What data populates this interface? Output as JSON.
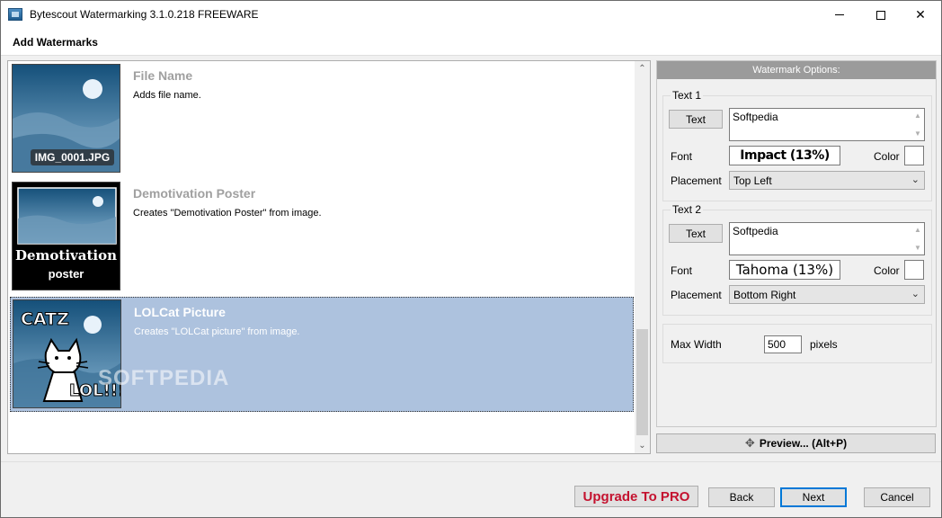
{
  "window": {
    "title": "Bytescout Watermarking 3.1.0.218 FREEWARE"
  },
  "header": {
    "title": "Add Watermarks"
  },
  "list": {
    "items": [
      {
        "title": "File Name",
        "description": "Adds file name.",
        "thumb_label": "IMG_0001.JPG"
      },
      {
        "title": "Demotivation Poster",
        "description": "Creates \"Demotivation Poster\" from image.",
        "thumb_line1": "Demotivation",
        "thumb_line2": "poster"
      },
      {
        "title": "LOLCat Picture",
        "description": "Creates \"LOLCat picture\" from image.",
        "thumb_top": "CATZ",
        "thumb_bottom": "LOL!!!",
        "selected": true
      }
    ],
    "overlay_watermark": "SOFTPEDIA"
  },
  "options": {
    "header": "Watermark Options:",
    "text1": {
      "legend": "Text 1",
      "button": "Text",
      "value": "Softpedia",
      "font_label": "Font",
      "font_value": "Impact (13%)",
      "color_label": "Color",
      "placement_label": "Placement",
      "placement_value": "Top Left"
    },
    "text2": {
      "legend": "Text 2",
      "button": "Text",
      "value": "Softpedia",
      "font_label": "Font",
      "font_value": "Tahoma (13%)",
      "color_label": "Color",
      "placement_label": "Placement",
      "placement_value": "Bottom Right"
    },
    "max_width": {
      "label": "Max Width",
      "value": "500",
      "unit": "pixels"
    }
  },
  "preview_button": "Preview... (Alt+P)",
  "footer": {
    "upgrade": "Upgrade To PRO",
    "back": "Back",
    "next": "Next",
    "cancel": "Cancel"
  },
  "colors": {
    "selection": "#adc2de",
    "upgrade_text": "#c4122f",
    "accent": "#0078d7"
  }
}
